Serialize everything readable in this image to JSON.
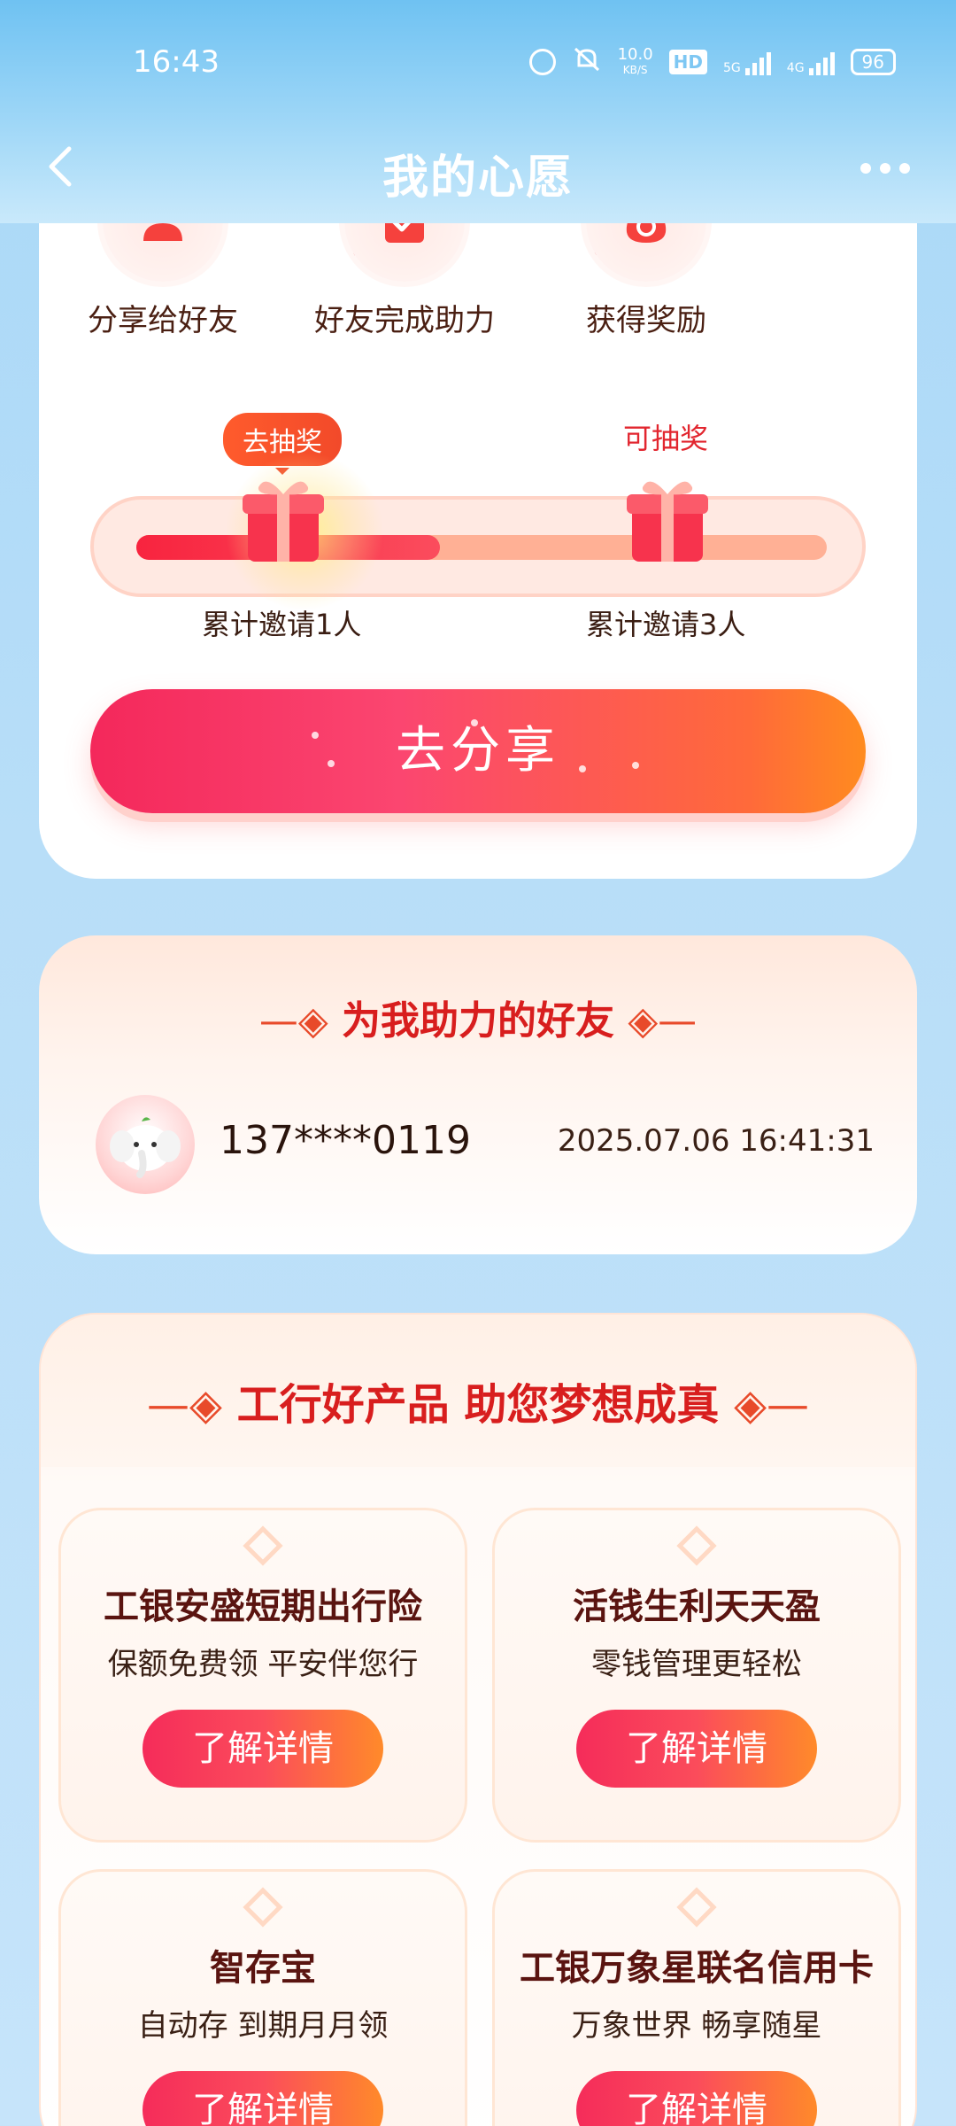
{
  "status_bar": {
    "time": "16:43",
    "net_speed": "10.0",
    "net_unit": "KB/S",
    "hd": "HD",
    "signal1": "5G",
    "signal2": "4G",
    "battery": "96"
  },
  "nav": {
    "title": "我的心愿"
  },
  "steps": [
    {
      "label": "分享给好友",
      "icon": "user-icon"
    },
    {
      "label": "好友完成助力",
      "icon": "clipboard-check-icon"
    },
    {
      "label": "获得奖励",
      "icon": "money-bag-icon"
    }
  ],
  "progress": {
    "tag_go": "去抽奖",
    "tag_can": "可抽奖",
    "milestone1": "累计邀请1人",
    "milestone2": "累计邀请3人",
    "fill_fraction": 0.44
  },
  "share_button": "去分享",
  "friends_section": {
    "title": "为我助力的好友",
    "friends": [
      {
        "phone": "137****0119",
        "time": "2025.07.06 16:41:31"
      }
    ]
  },
  "products_section": {
    "title": "工行好产品 助您梦想成真",
    "items": [
      {
        "title": "工银安盛短期出行险",
        "subtitle": "保额免费领 平安伴您行",
        "button": "了解详情"
      },
      {
        "title": "活钱生利天天盈",
        "subtitle": "零钱管理更轻松",
        "button": "了解详情"
      },
      {
        "title": "智存宝",
        "subtitle": "自动存 到期月月领",
        "button": "了解详情"
      },
      {
        "title": "工银万象星联名信用卡",
        "subtitle": "万象世界 畅享随星",
        "button": "了解详情"
      }
    ]
  },
  "colors": {
    "accent_red": "#e4393c",
    "title_red": "#d81e1e",
    "header_blue": "#6fc2f2"
  }
}
